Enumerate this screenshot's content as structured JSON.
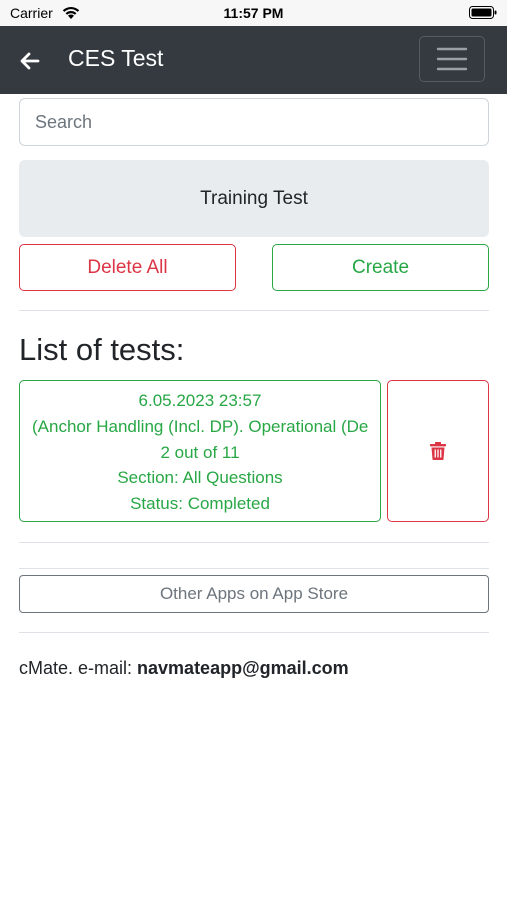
{
  "status_bar": {
    "carrier": "Carrier",
    "time": "11:57 PM"
  },
  "navbar": {
    "back_icon": "arrow-left-icon",
    "title": "CES Test",
    "menu_icon": "hamburger-icon",
    "background_color": "#343a40"
  },
  "search": {
    "placeholder": "Search",
    "value": ""
  },
  "training_button": {
    "label": "Training Test"
  },
  "actions": {
    "delete_all_label": "Delete All",
    "create_label": "Create",
    "danger_color": "#dc3545",
    "success_color": "#28a745"
  },
  "tests": {
    "heading": "List of tests:",
    "items": [
      {
        "date": "6.05.2023 23:57",
        "name": "(Anchor Handling (Incl. DP). Operational (De",
        "score": "2 out of 11",
        "section": "Section: All Questions",
        "status": "Status: Completed",
        "delete_icon": "trash-icon"
      }
    ]
  },
  "other_apps": {
    "label": "Other Apps on App Store"
  },
  "contact": {
    "prefix": "cMate. e-mail: ",
    "email": "navmateapp@gmail.com"
  }
}
